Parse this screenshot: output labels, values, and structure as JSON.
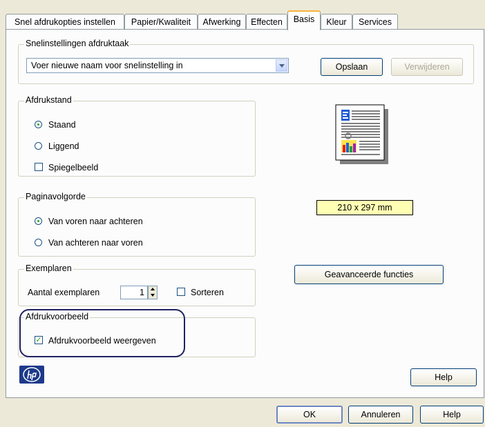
{
  "tabs": [
    {
      "label": "Snel afdrukopties instellen"
    },
    {
      "label": "Papier/Kwaliteit"
    },
    {
      "label": "Afwerking"
    },
    {
      "label": "Effecten"
    },
    {
      "label": "Basis"
    },
    {
      "label": "Kleur"
    },
    {
      "label": "Services"
    }
  ],
  "active_tab": "Basis",
  "quick_settings": {
    "group_label": "Snelinstellingen afdruktaak",
    "combo_value": "Voer nieuwe naam voor snelinstelling in",
    "save_label": "Opslaan",
    "delete_label": "Verwijderen"
  },
  "orientation": {
    "group_label": "Afdrukstand",
    "portrait_label": "Staand",
    "landscape_label": "Liggend",
    "mirror_label": "Spiegelbeeld",
    "portrait_selected": true,
    "mirror_checked": false
  },
  "page_order": {
    "group_label": "Paginavolgorde",
    "front_to_back_label": "Van voren naar achteren",
    "back_to_front_label": "Van achteren naar voren"
  },
  "copies": {
    "group_label": "Exemplaren",
    "count_label": "Aantal exemplaren",
    "count_value": "1",
    "collate_label": "Sorteren",
    "collate_checked": false
  },
  "preview": {
    "group_label": "Afdrukvoorbeeld",
    "show_label": "Afdrukvoorbeeld weergeven",
    "show_checked": true
  },
  "paper_size": "210 x 297 mm",
  "advanced_label": "Geavanceerde functies",
  "help_label": "Help",
  "footer": {
    "ok_label": "OK",
    "cancel_label": "Annuleren",
    "help_label": "Help"
  },
  "colors": {
    "highlight": "#202060",
    "paper_label_bg": "#ffffb4",
    "hp_logo": "#1d3a8a"
  }
}
